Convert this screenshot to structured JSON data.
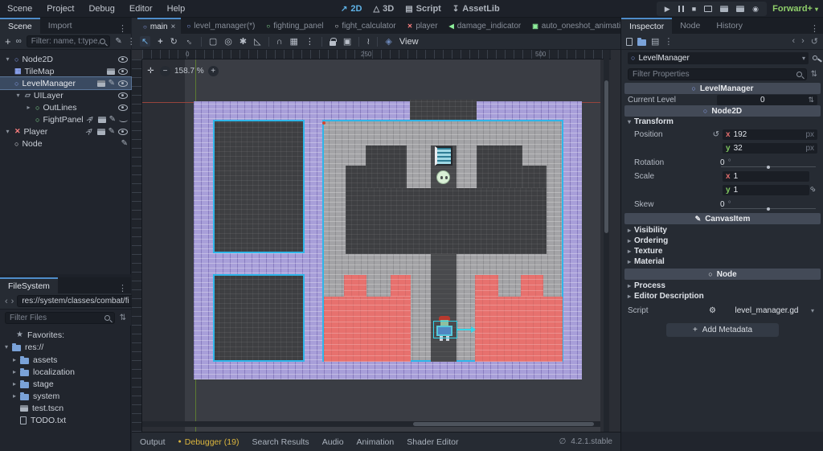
{
  "menu": {
    "items": [
      "Scene",
      "Project",
      "Debug",
      "Editor",
      "Help"
    ]
  },
  "workspaces": {
    "items": [
      {
        "label": "2D",
        "active": true
      },
      {
        "label": "3D",
        "active": false
      },
      {
        "label": "Script",
        "active": false
      },
      {
        "label": "AssetLib",
        "active": false
      }
    ]
  },
  "playback": {
    "run_mode": "Forward+"
  },
  "scene_dock": {
    "tabs": [
      "Scene",
      "Import"
    ],
    "filter_placeholder": "Filter: name, t:type,",
    "items": [
      {
        "label": "Node2D",
        "type": "Node2D"
      },
      {
        "label": "TileMap",
        "type": "TileMap"
      },
      {
        "label": "LevelManager",
        "type": "Node2D",
        "selected": true
      },
      {
        "label": "UILayer",
        "type": "CanvasLayer"
      },
      {
        "label": "OutLines",
        "type": "Control"
      },
      {
        "label": "FightPanel",
        "type": "Control"
      },
      {
        "label": "Player",
        "type": "CharacterBody2D"
      },
      {
        "label": "Node",
        "type": "Node"
      }
    ]
  },
  "filesystem": {
    "tab": "FileSystem",
    "path": "res://system/classes/combat/fi",
    "filter_placeholder": "Filter Files",
    "items": [
      {
        "label": "Favorites:",
        "icon": "star"
      },
      {
        "label": "res://",
        "icon": "folder"
      },
      {
        "label": "assets",
        "icon": "folder"
      },
      {
        "label": "localization",
        "icon": "folder"
      },
      {
        "label": "stage",
        "icon": "folder"
      },
      {
        "label": "system",
        "icon": "folder"
      },
      {
        "label": "test.tscn",
        "icon": "scene"
      },
      {
        "label": "TODO.txt",
        "icon": "text-file"
      }
    ]
  },
  "viewport": {
    "tabs": [
      {
        "label": "main",
        "active": true
      },
      {
        "label": "level_manager(*)"
      },
      {
        "label": "fighting_panel"
      },
      {
        "label": "fight_calculator"
      },
      {
        "label": "player"
      },
      {
        "label": "damage_indicator"
      },
      {
        "label": "auto_oneshot_animation"
      }
    ],
    "view_button": "View",
    "zoom": "158.7 %",
    "ruler_labels": [
      "0",
      "250",
      "500"
    ]
  },
  "inspector": {
    "tabs": [
      "Inspector",
      "Node",
      "History"
    ],
    "node_name": "LevelManager",
    "filter_placeholder": "Filter Properties",
    "categories": [
      "LevelManager",
      "Node2D",
      "CanvasItem",
      "Node"
    ],
    "current_level": {
      "label": "Current Level",
      "value": "0"
    },
    "transform_label": "Transform",
    "position": {
      "label": "Position",
      "x_label": "x",
      "x": "192",
      "y_label": "y",
      "y": "32",
      "unit": "px"
    },
    "rotation": {
      "label": "Rotation",
      "value": "0",
      "unit": "°"
    },
    "scale": {
      "label": "Scale",
      "x_label": "x",
      "x": "1",
      "y_label": "y",
      "y": "1"
    },
    "skew": {
      "label": "Skew",
      "value": "0",
      "unit": "°"
    },
    "canvasitem_sections": [
      "Visibility",
      "Ordering",
      "Texture",
      "Material"
    ],
    "node_sections": [
      "Process",
      "Editor Description"
    ],
    "script": {
      "label": "Script",
      "file": "level_manager.gd"
    },
    "add_metadata": "Add Metadata"
  },
  "bottom_bar": {
    "items": [
      "Output",
      "Debugger (19)",
      "Search Results",
      "Audio",
      "Animation",
      "Shader Editor"
    ],
    "version": "4.2.1.stable"
  },
  "map": {
    "colors": {
      "border_purple": "#a89fd9",
      "stone_light": "#a3a3a6",
      "stone_dark": "#3e3f42",
      "lava_red": "#e7716e",
      "outline_cyan": "#2fb6e9",
      "stairs_teal": "#63b9cf",
      "smiley_green": "#d9efd6",
      "accent_blue": "#5fa8e0",
      "accent_green": "#8fce6a"
    }
  }
}
